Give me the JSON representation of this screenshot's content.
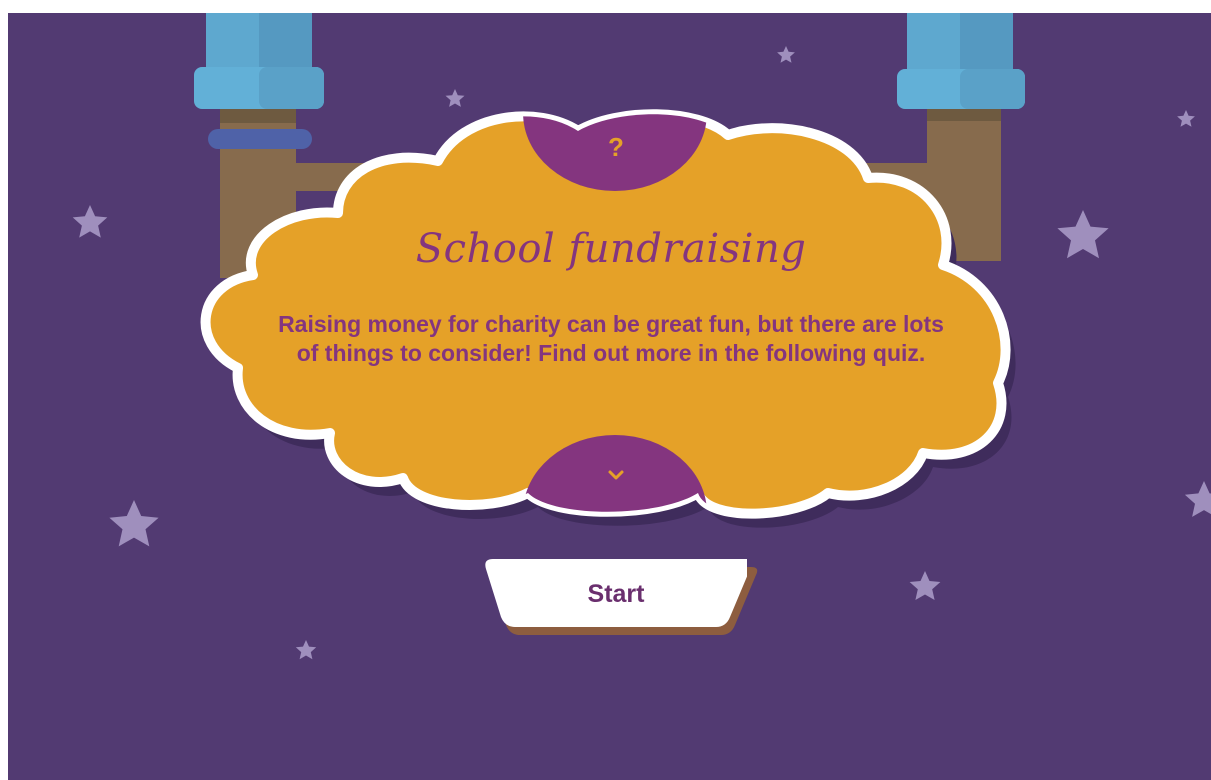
{
  "quiz": {
    "title": "School fundraising",
    "description": "Raising money for charity can be great fun, but there are lots of things to consider! Find out more in the following quiz.",
    "question_mark": "?",
    "start_label": "Start"
  },
  "colors": {
    "background": "#523a72",
    "cloud": "#e5a128",
    "accent_purple": "#84357f",
    "pipe_blue": "#5ea8cf",
    "pipe_brown": "#876b4d",
    "star": "#9f8fbd"
  },
  "icons": {
    "top_badge": "question-mark-icon",
    "bottom_badge": "chevron-down-icon"
  }
}
